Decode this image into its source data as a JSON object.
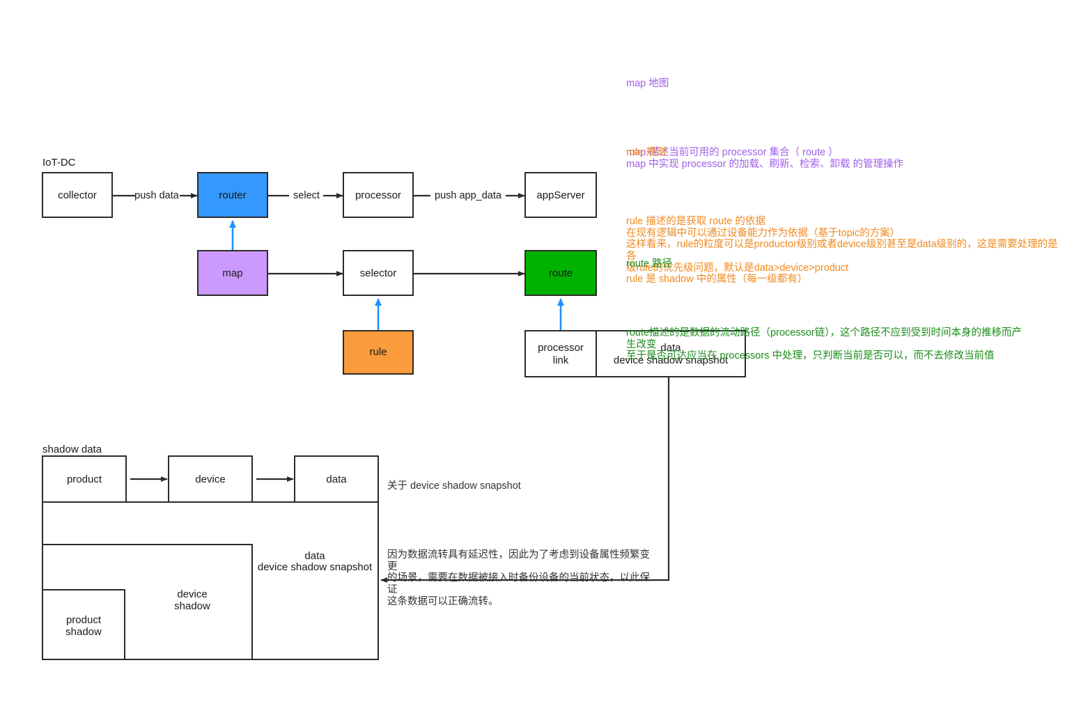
{
  "diagram": {
    "groups": {
      "iot_dc_label": "IoT-DC",
      "shadow_data_label": "shadow data"
    },
    "nodes": {
      "collector": "collector",
      "router": "router",
      "processor": "processor",
      "app_server": "appServer",
      "map": "map",
      "selector": "selector",
      "route": "route",
      "rule": "rule",
      "processor_link_1": "processor",
      "processor_link_2": "link",
      "snapshot_top_1": "data",
      "snapshot_top_2": "device shadow snapshot",
      "product": "product",
      "device": "device",
      "data": "data",
      "snapshot_bottom_1": "data",
      "snapshot_bottom_2": "device shadow snapshot",
      "device_shadow_1": "device",
      "device_shadow_2": "shadow",
      "product_shadow_1": "product",
      "product_shadow_2": "shadow"
    },
    "edges": {
      "push_data": "push data",
      "select": "select",
      "push_app_data": "push app_data"
    },
    "colors": {
      "router_fill": "#3399FF",
      "map_fill": "#CC99FF",
      "rule_fill": "#FA9B3C",
      "route_fill": "#00B200",
      "box_stroke": "#2b2b2b",
      "blue_arrow": "#1E90FF",
      "note_purple": "#A05EEA",
      "note_orange": "#F08A1E",
      "note_green": "#1A8C1A",
      "note_black": "#333333"
    }
  },
  "notes": {
    "map": {
      "title": "map 地图",
      "body": "map 描述当前可用的 processor 集合（ route ）\nmap 中实现 processor 的加载、刷新、检索、卸载 的管理操作"
    },
    "rule": {
      "title": "rule 规则",
      "body": "rule 描述的是获取 route 的依据\n在现有逻辑中可以通过设备能力作为依据（基于topic的方案）\n这样看来，rule的粒度可以是productor级别或者device级别甚至是data级别的，这是需要处理的是各\n级rule的优先级问题，默认是data>device>product\nrule 是 shadow 中的属性（每一级都有）"
    },
    "route": {
      "title": "route 路径",
      "body": "route描述的是数据的流动路径（processor链），这个路径不应到受到时间本身的推移而产\n生改变\n至于是否可达应当在 processors 中处理，只判断当前是否可以，而不去修改当前值"
    },
    "snapshot": {
      "title": "关于 device shadow snapshot",
      "body": "因为数据流转具有延迟性，因此为了考虑到设备属性频繁变更\n的场景，需要在数据被接入时备份设备的当前状态，以此保证\n这条数据可以正确流转。"
    }
  }
}
